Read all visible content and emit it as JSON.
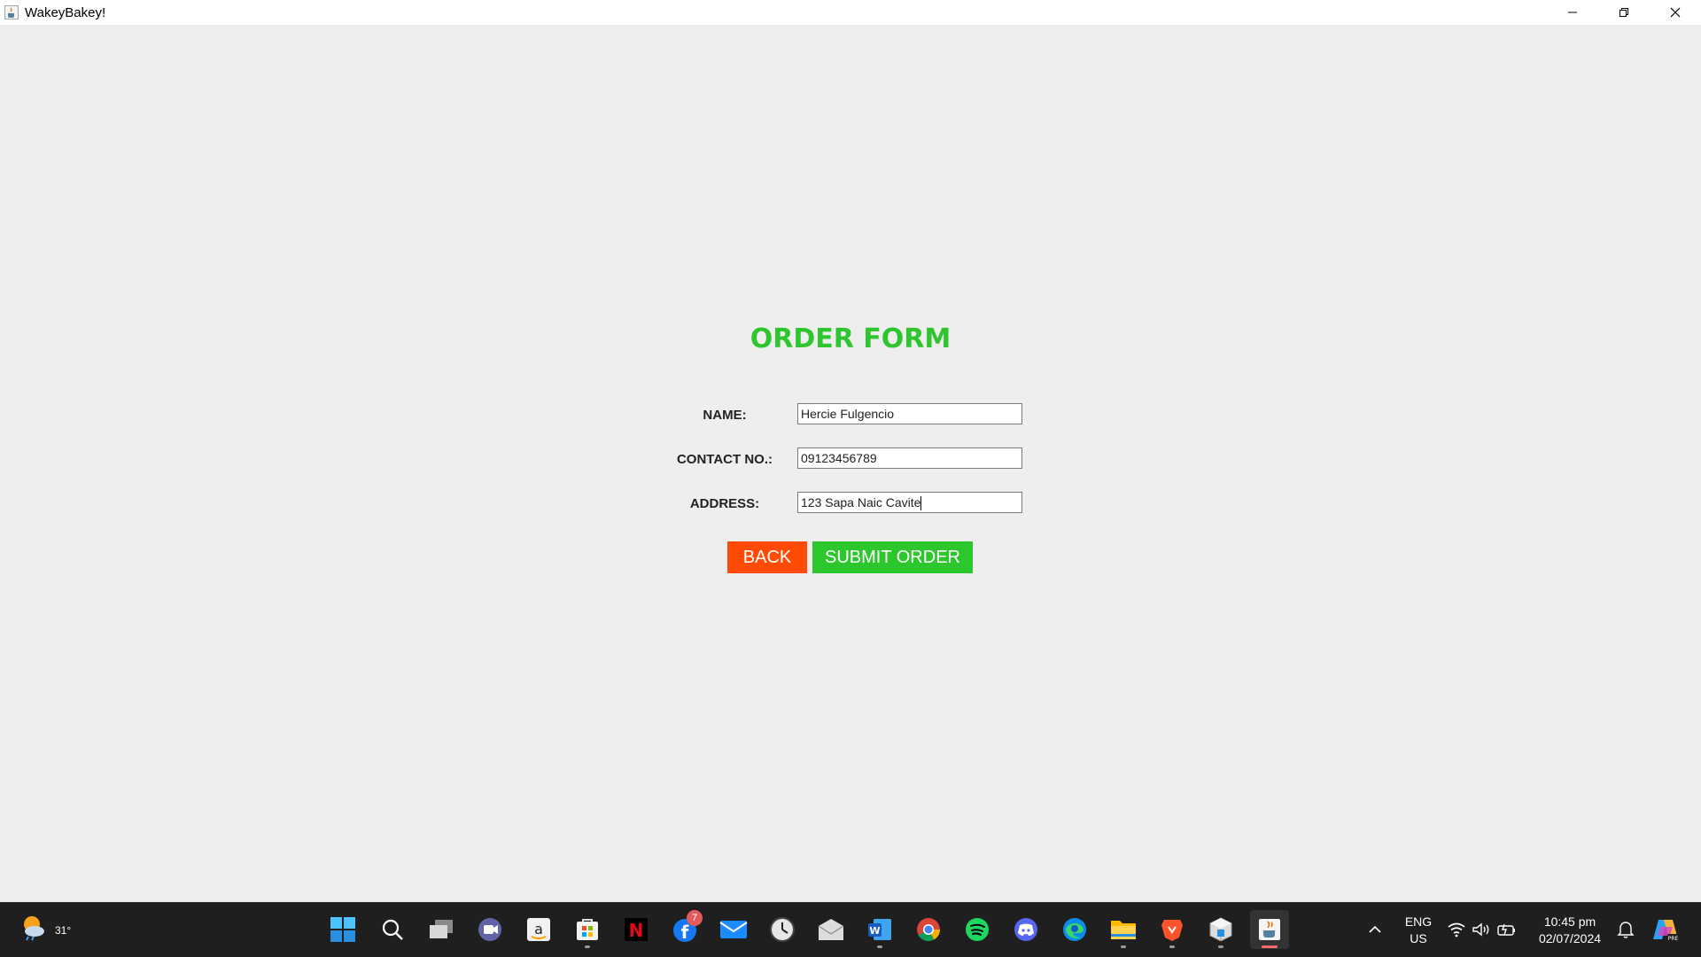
{
  "window": {
    "title": "WakeyBakey!",
    "icon": "java-cup-icon"
  },
  "form": {
    "title": "ORDER FORM",
    "title_color": "#2ec52e",
    "fields": [
      {
        "label": "NAME:",
        "value": "Hercie Fulgencio"
      },
      {
        "label": "CONTACT NO.:",
        "value": "09123456789"
      },
      {
        "label": "ADDRESS:",
        "value": "123 Sapa Naic Cavite"
      }
    ],
    "back_label": "BACK",
    "back_color": "#ff4b06",
    "submit_label": "SUBMIT ORDER",
    "submit_color": "#2cc72c"
  },
  "taskbar": {
    "weather_temp": "31°",
    "facebook_badge": "7",
    "language": "ENG",
    "region": "US",
    "time": "10:45 pm",
    "date": "02/07/2024",
    "apps": [
      "start-icon",
      "search-icon",
      "task-view-icon",
      "teams-icon",
      "amazon-icon",
      "microsoft-store-icon",
      "netflix-icon",
      "facebook-icon",
      "mail-icon",
      "clock-icon",
      "email-client-icon",
      "word-icon",
      "chrome-icon",
      "spotify-icon",
      "discord-icon",
      "edge-icon",
      "file-explorer-icon",
      "brave-icon",
      "virtual-box-icon",
      "java-icon"
    ]
  }
}
